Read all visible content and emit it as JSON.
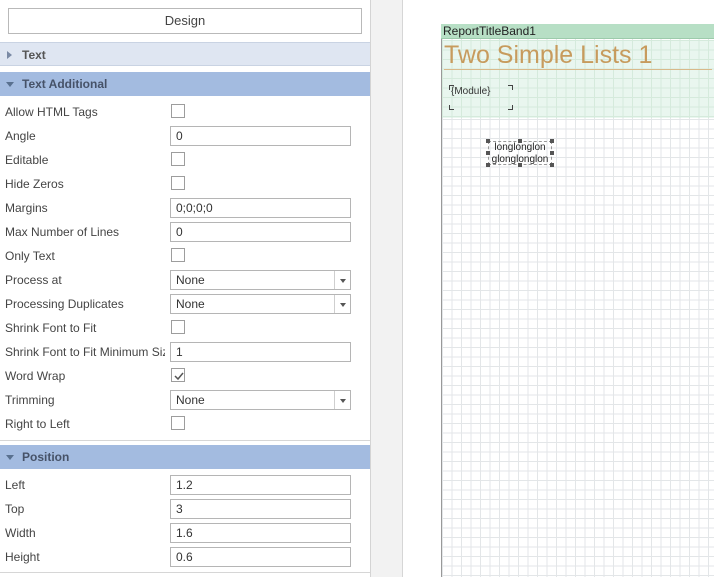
{
  "panel": {
    "design_button": "Design",
    "sections": {
      "text": {
        "label": "Text",
        "state": "collapsed"
      },
      "text_additional": {
        "label": "Text Additional",
        "state": "expanded"
      },
      "position": {
        "label": "Position",
        "state": "expanded"
      }
    },
    "text_additional_props": [
      {
        "label": "Allow HTML Tags",
        "type": "checkbox",
        "checked": false
      },
      {
        "label": "Angle",
        "type": "text",
        "value": "0"
      },
      {
        "label": "Editable",
        "type": "checkbox",
        "checked": false
      },
      {
        "label": "Hide Zeros",
        "type": "checkbox",
        "checked": false
      },
      {
        "label": "Margins",
        "type": "text",
        "value": "0;0;0;0"
      },
      {
        "label": "Max Number of Lines",
        "type": "text",
        "value": "0"
      },
      {
        "label": "Only Text",
        "type": "checkbox",
        "checked": false
      },
      {
        "label": "Process at",
        "type": "select",
        "value": "None"
      },
      {
        "label": "Processing Duplicates",
        "type": "select",
        "value": "None"
      },
      {
        "label": "Shrink Font to Fit",
        "type": "checkbox",
        "checked": false
      },
      {
        "label": "Shrink Font to Fit Minimum Size",
        "type": "text",
        "value": "1"
      },
      {
        "label": "Word Wrap",
        "type": "checkbox",
        "checked": true
      },
      {
        "label": "Trimming",
        "type": "select",
        "value": "None"
      },
      {
        "label": "Right to Left",
        "type": "checkbox",
        "checked": false
      }
    ],
    "position_props": [
      {
        "label": "Left",
        "type": "text",
        "value": "1.2"
      },
      {
        "label": "Top",
        "type": "text",
        "value": "3"
      },
      {
        "label": "Width",
        "type": "text",
        "value": "1.6"
      },
      {
        "label": "Height",
        "type": "text",
        "value": "0.6"
      }
    ]
  },
  "canvas": {
    "band_name": "ReportTitleBand1",
    "title": "Two Simple Lists 1",
    "module_text": "{Module}",
    "selected_text_line1": "longlonglon",
    "selected_text_line2": "glonglonglon"
  },
  "colors": {
    "section_header_expanded": "#a3bbe0",
    "section_header_collapsed": "#dfe6f2",
    "band_header": "#b7dfc5",
    "title_text": "#c79b5d"
  }
}
